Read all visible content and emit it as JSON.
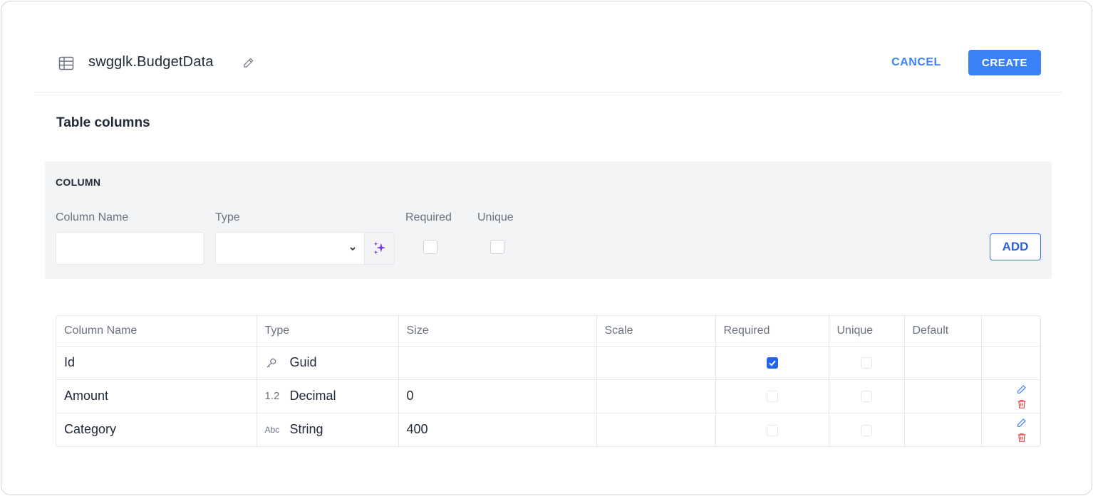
{
  "header": {
    "title": "swgglk.BudgetData",
    "cancel_label": "CANCEL",
    "create_label": "CREATE"
  },
  "section_title": "Table columns",
  "add_panel": {
    "heading": "COLUMN",
    "column_name_label": "Column Name",
    "column_name_value": "",
    "type_label": "Type",
    "type_value": "",
    "required_label": "Required",
    "unique_label": "Unique",
    "required_checked": false,
    "unique_checked": false,
    "add_label": "ADD"
  },
  "columns_table": {
    "headers": [
      "Column Name",
      "Type",
      "Size",
      "Scale",
      "Required",
      "Unique",
      "Default",
      ""
    ],
    "rows": [
      {
        "name": "Id",
        "type_icon": "key-icon",
        "type": "Guid",
        "size": "",
        "scale": "",
        "required": true,
        "unique": false,
        "default": "",
        "editable": false
      },
      {
        "name": "Amount",
        "type_icon": "decimal-icon",
        "type_icon_text": "1.2",
        "type": "Decimal",
        "size": "0",
        "scale": "",
        "required": false,
        "unique": false,
        "default": "",
        "editable": true
      },
      {
        "name": "Category",
        "type_icon": "string-icon",
        "type_icon_text": "Abc",
        "type": "String",
        "size": "400",
        "scale": "",
        "required": false,
        "unique": false,
        "default": "",
        "editable": true
      }
    ]
  },
  "colors": {
    "accent": "#3b82f6",
    "delete": "#ef4444",
    "panel_bg": "#f3f4f6",
    "magic": "#7c3aed"
  }
}
